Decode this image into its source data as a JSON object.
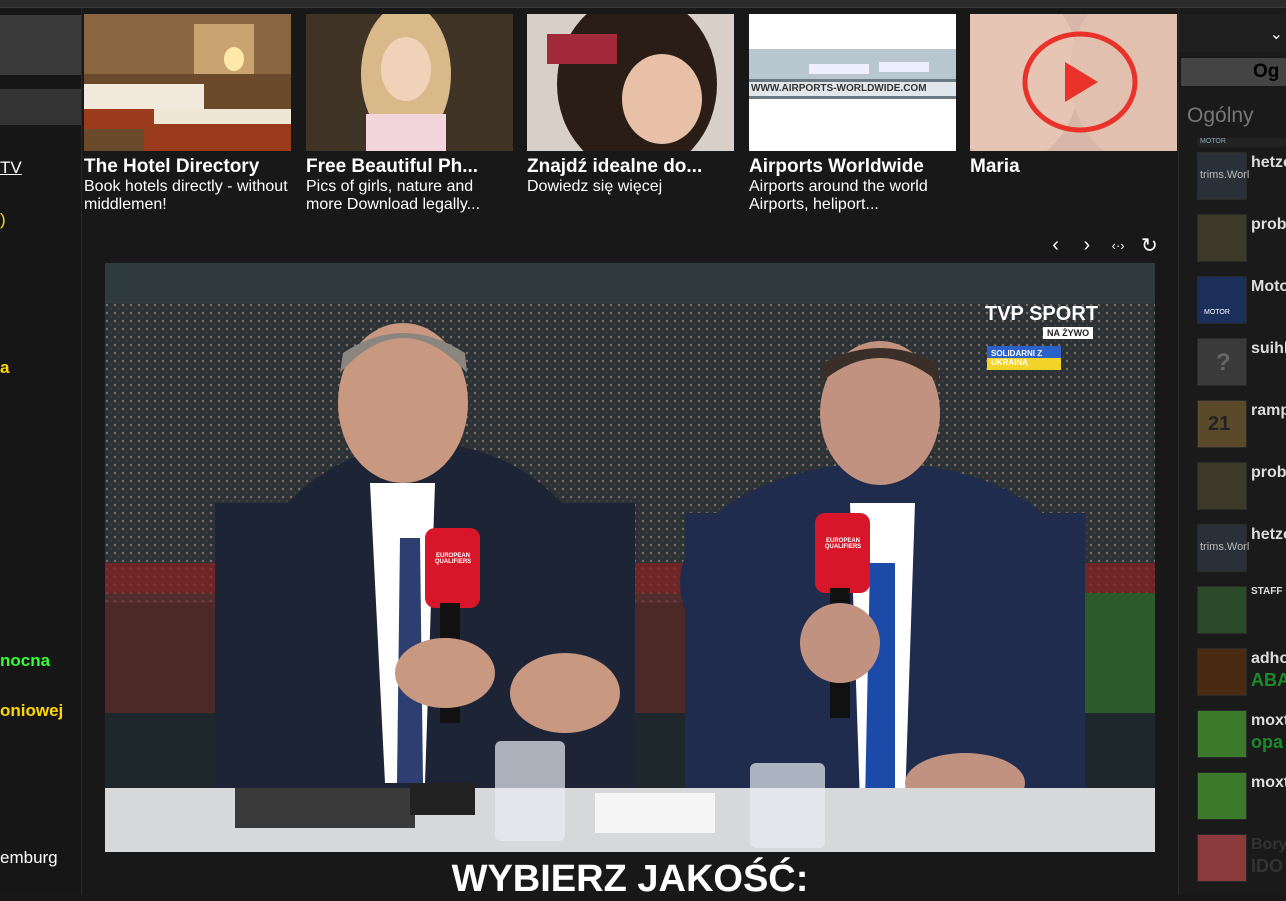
{
  "left_sidebar": {
    "items": [
      {
        "text": "TV",
        "color": "#ffffff"
      },
      {
        "text": ")",
        "color": "#ffd700"
      },
      {
        "text": "a",
        "color": "#ffd700"
      },
      {
        "text": "nocna",
        "color": "#33ff33"
      },
      {
        "text": "oniowej",
        "color": "#ffd700"
      },
      {
        "text": "emburg",
        "color": "#ffffff"
      }
    ]
  },
  "ads": [
    {
      "title": "The Hotel Directory",
      "desc": "Book hotels directly - without middlemen!"
    },
    {
      "title": "Free Beautiful Ph...",
      "desc": "Pics of girls, nature and more Download legally..."
    },
    {
      "title": "Znajdź idealne do...",
      "desc": "Dowiedz się więcej"
    },
    {
      "title": "Airports Worldwide",
      "desc": "Airports around the world Airports, heliport...",
      "banner_text": "WWW.AIRPORTS-WORLDWIDE.COM"
    },
    {
      "title": "Maria",
      "desc": ""
    }
  ],
  "controls": {
    "prev": "‹",
    "next": "›",
    "expand": "‹·›",
    "refresh": "↻"
  },
  "video": {
    "channel": "TVP SPORT",
    "live": "NA ŻYWO",
    "ribbon": "SOLIDARNI Z UKRAINĄ",
    "mic": "EUROPEAN QUALIFIERS"
  },
  "quality_label": "WYBIERZ JAKOŚĆ:",
  "right_panel": {
    "tab_label": "Og",
    "section_title": "Ogólny",
    "top_strip": "MOTOR",
    "users": [
      {
        "name": "hetzo",
        "sub": "",
        "sub_color": "#ffffff",
        "avatar": "trims.Worl"
      },
      {
        "name": "prob",
        "sub": "",
        "sub_color": "#ffffff",
        "avatar": ""
      },
      {
        "name": "Moto",
        "sub": "",
        "sub_color": "#ffffff",
        "avatar": "MOTOR"
      },
      {
        "name": "suihl",
        "sub": "",
        "sub_color": "#ffffff",
        "avatar": "?"
      },
      {
        "name": "ramp",
        "sub": "",
        "sub_color": "#ffffff",
        "avatar": "21"
      },
      {
        "name": "prob",
        "sub": "",
        "sub_color": "#ffffff",
        "avatar": ""
      },
      {
        "name": "hetzo",
        "sub": "",
        "sub_color": "#ffffff",
        "avatar": "trims.Worl"
      },
      {
        "name": "STAFF",
        "sub": "",
        "sub_color": "#ffffff",
        "avatar": ""
      },
      {
        "name": "adho",
        "sub": "ABA",
        "sub_color": "#1a8a2a",
        "avatar": ""
      },
      {
        "name": "moxt",
        "sub": "opa",
        "sub_color": "#1a8a2a",
        "avatar": ""
      },
      {
        "name": "moxt",
        "sub": "",
        "sub_color": "#ffffff",
        "avatar": ""
      },
      {
        "name": "Bory",
        "sub": "IDO",
        "sub_color": "#333333",
        "avatar": ""
      }
    ]
  }
}
